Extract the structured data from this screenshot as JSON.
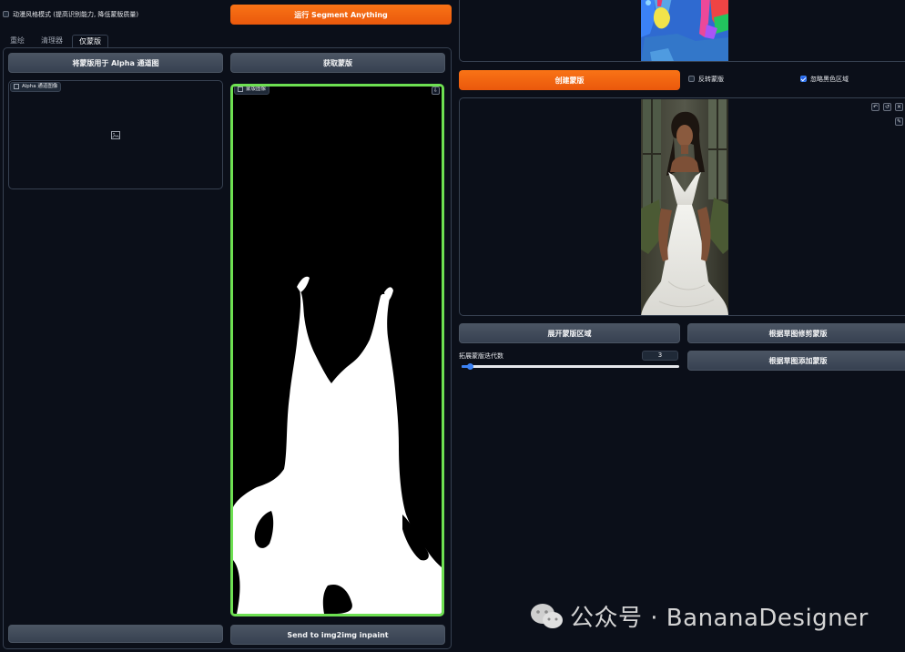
{
  "anime_mode": {
    "label": "动漫风格模式 (提高识别能力, 降低蒙版质量)",
    "checked": false
  },
  "run_sam_button": "运行 Segment Anything",
  "tabs": [
    {
      "label": "重绘",
      "selected": false
    },
    {
      "label": "清理器",
      "selected": false
    },
    {
      "label": "仅蒙版",
      "selected": true
    }
  ],
  "left": {
    "apply_alpha_button": "将蒙版用于 Alpha 通道图",
    "get_mask_button": "获取蒙版",
    "alpha_image_label": "Alpha 通道图像",
    "mask_image_label": "蒙版图像",
    "send_button": "Send to img2img inpaint"
  },
  "right": {
    "create_mask_button": "创建蒙版",
    "invert_mask": {
      "label": "反转蒙版",
      "checked": false
    },
    "ignore_black": {
      "label": "忽略黑色区域",
      "checked": true
    },
    "expand_mask_button": "展开蒙版区域",
    "trim_by_sketch_button": "根据草图修剪蒙版",
    "add_by_sketch_button": "根据草图添加蒙版",
    "dilation_label": "拓展蒙版迭代数",
    "dilation_value": "3",
    "dilation_fraction": 0.03
  },
  "watermark": "公众号 · BananaDesigner",
  "colors": {
    "accent": "#f97316",
    "mask_border": "#6ee052",
    "bg": "#0b0f19"
  }
}
